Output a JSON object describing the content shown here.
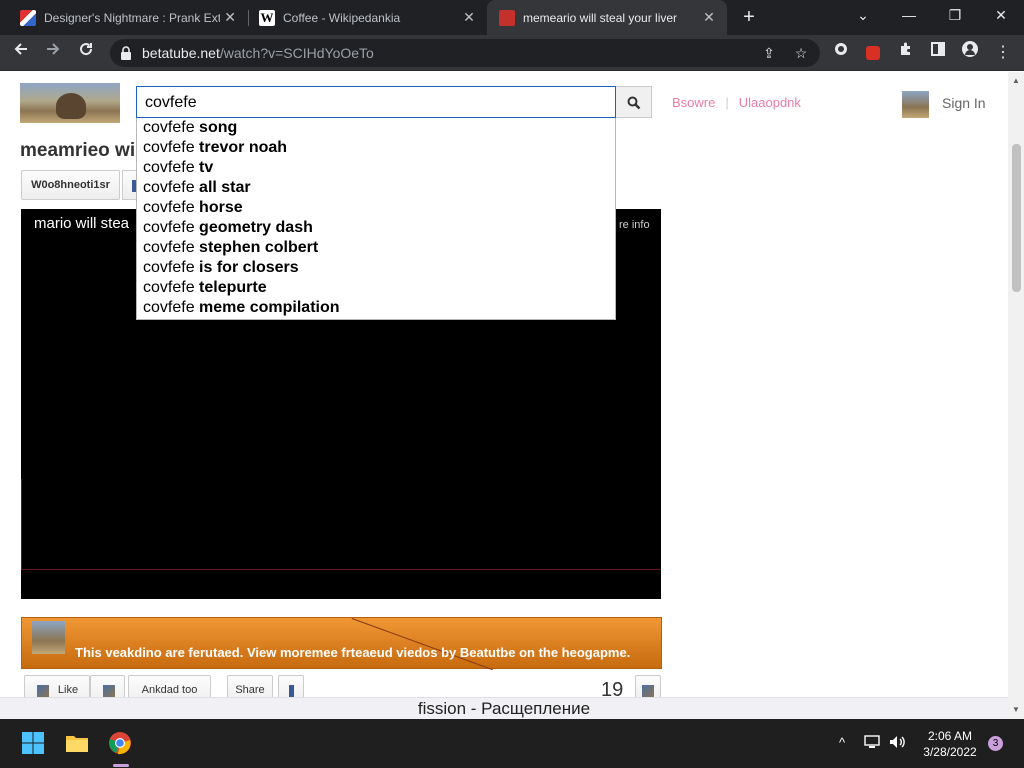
{
  "browser": {
    "tabs": [
      {
        "title": "Designer's Nightmare : Prank Ext",
        "close": "✕"
      },
      {
        "title": "Coffee - Wikipedankia",
        "close": "✕"
      },
      {
        "title": "memeario will steal your liver",
        "close": "✕"
      }
    ],
    "new_tab": "+",
    "window_controls": {
      "dropdown": "⌄",
      "minimize": "—",
      "restore": "❐",
      "close": "✕"
    },
    "url_host": "betatube.net",
    "url_path": "/watch?v=SCIHdYoOeTo"
  },
  "site": {
    "search": {
      "value": "covfefe"
    },
    "suggestions": [
      {
        "prefix": "covfefe",
        "completion": "song"
      },
      {
        "prefix": "covfefe",
        "completion": "trevor noah"
      },
      {
        "prefix": "covfefe",
        "completion": "tv"
      },
      {
        "prefix": "covfefe",
        "completion": "all star"
      },
      {
        "prefix": "covfefe",
        "completion": "horse"
      },
      {
        "prefix": "covfefe",
        "completion": "geometry dash"
      },
      {
        "prefix": "covfefe",
        "completion": "stephen colbert"
      },
      {
        "prefix": "covfefe",
        "completion": "is for closers"
      },
      {
        "prefix": "covfefe",
        "completion": "telepurte"
      },
      {
        "prefix": "covfefe",
        "completion": "meme compilation"
      }
    ],
    "nav": {
      "browse": "Bsowre",
      "upload": "Ulaaopdnk",
      "separator": "|"
    },
    "sign_in": "Sign In",
    "video_title": "meamrieo wi",
    "channel_button": "W0o8hneoti1sr",
    "player": {
      "title": "mario will stea",
      "more_info": "re info"
    },
    "banner_text": "This veakdino are ferutaed. View moremee frteaeud viedos by Beatutbe on the heogapme.",
    "actions": {
      "like": "Like",
      "add_to": "Ankdad too",
      "share": "Share"
    },
    "views": "19"
  },
  "caption": "fission - Расщепление",
  "taskbar": {
    "time": "2:06 AM",
    "date": "3/28/2022",
    "notifications": "3",
    "chevron": "^"
  }
}
